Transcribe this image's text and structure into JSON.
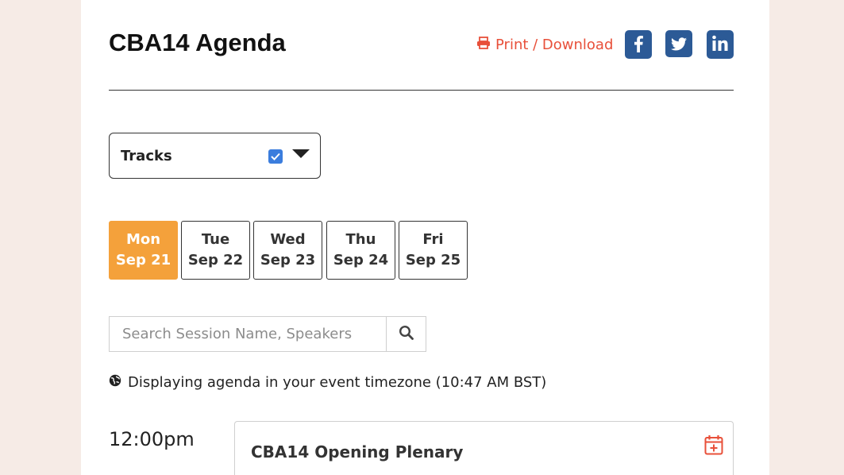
{
  "header": {
    "title": "CBA14 Agenda",
    "print_label": "Print / Download",
    "share_icons": [
      "facebook-icon",
      "twitter-icon",
      "linkedin-icon"
    ]
  },
  "filters": {
    "tracks_label": "Tracks",
    "tracks_checked": true
  },
  "days": [
    {
      "weekday": "Mon",
      "date": "Sep 21",
      "active": true
    },
    {
      "weekday": "Tue",
      "date": "Sep 22",
      "active": false
    },
    {
      "weekday": "Wed",
      "date": "Sep 23",
      "active": false
    },
    {
      "weekday": "Thu",
      "date": "Sep 24",
      "active": false
    },
    {
      "weekday": "Fri",
      "date": "Sep 25",
      "active": false
    }
  ],
  "search": {
    "placeholder": "Search Session Name, Speakers",
    "value": ""
  },
  "timezone": {
    "text": "Displaying agenda in your event timezone (10:47 AM BST)"
  },
  "schedule": [
    {
      "time": "12:00pm",
      "title": "CBA14 Opening Plenary"
    }
  ],
  "colors": {
    "accent": "#f4a13b",
    "link": "#e8503a",
    "social": "#2c5a96",
    "background": "#f6ebe6"
  }
}
